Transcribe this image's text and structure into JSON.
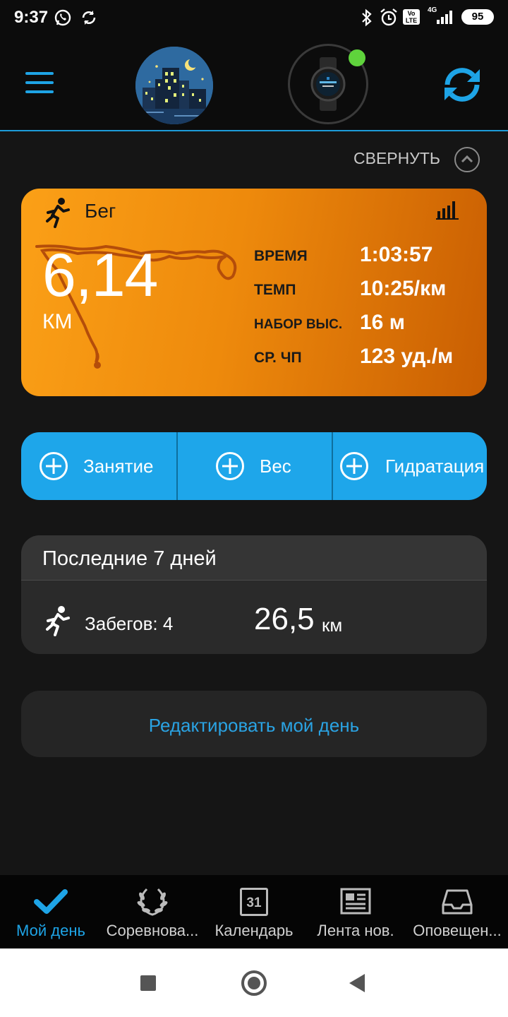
{
  "status_bar": {
    "time": "9:37",
    "network": "4G",
    "volte": "Vo LTE",
    "battery": "95"
  },
  "header": {
    "menu_icon": "hamburger-icon",
    "avatar_icon": "night-city-avatar",
    "device_icon": "smartwatch-icon",
    "device_connected_color": "#5fd33c",
    "sync_icon": "sync-icon",
    "accent_color": "#1ea4e6"
  },
  "collapse": {
    "label": "СВЕРНУТЬ",
    "icon": "chevron-up-icon"
  },
  "activity": {
    "icon": "running-icon",
    "title": "Бег",
    "chart_icon": "bar-chart-icon",
    "distance": "6,14",
    "unit": "КМ",
    "stats": [
      {
        "label": "ВРЕМЯ",
        "value": "1:03:57"
      },
      {
        "label": "ТЕМП",
        "value": "10:25/км"
      },
      {
        "label": "НАБОР ВЫС.",
        "value": "16 м"
      },
      {
        "label": "СР. ЧП",
        "value": "123 уд./м"
      }
    ]
  },
  "quick_add": [
    {
      "icon": "plus-circle-icon",
      "label": "Занятие"
    },
    {
      "icon": "plus-circle-icon",
      "label": "Вес"
    },
    {
      "icon": "plus-circle-icon",
      "label": "Гидратация"
    }
  ],
  "last_week": {
    "title": "Последние 7 дней",
    "runs_label": "Забегов: 4",
    "distance": "26,5",
    "unit": "км"
  },
  "edit_day": {
    "label": "Редактировать мой день"
  },
  "bottom_nav": [
    {
      "icon": "checkmark-icon",
      "label": "Мой день",
      "active": true
    },
    {
      "icon": "laurel-icon",
      "label": "Соревнова...",
      "active": false
    },
    {
      "icon": "calendar-icon",
      "label": "Календарь",
      "active": false,
      "calendar_day": "31"
    },
    {
      "icon": "newspaper-icon",
      "label": "Лента нов.",
      "active": false
    },
    {
      "icon": "inbox-icon",
      "label": "Оповещен...",
      "active": false
    }
  ]
}
